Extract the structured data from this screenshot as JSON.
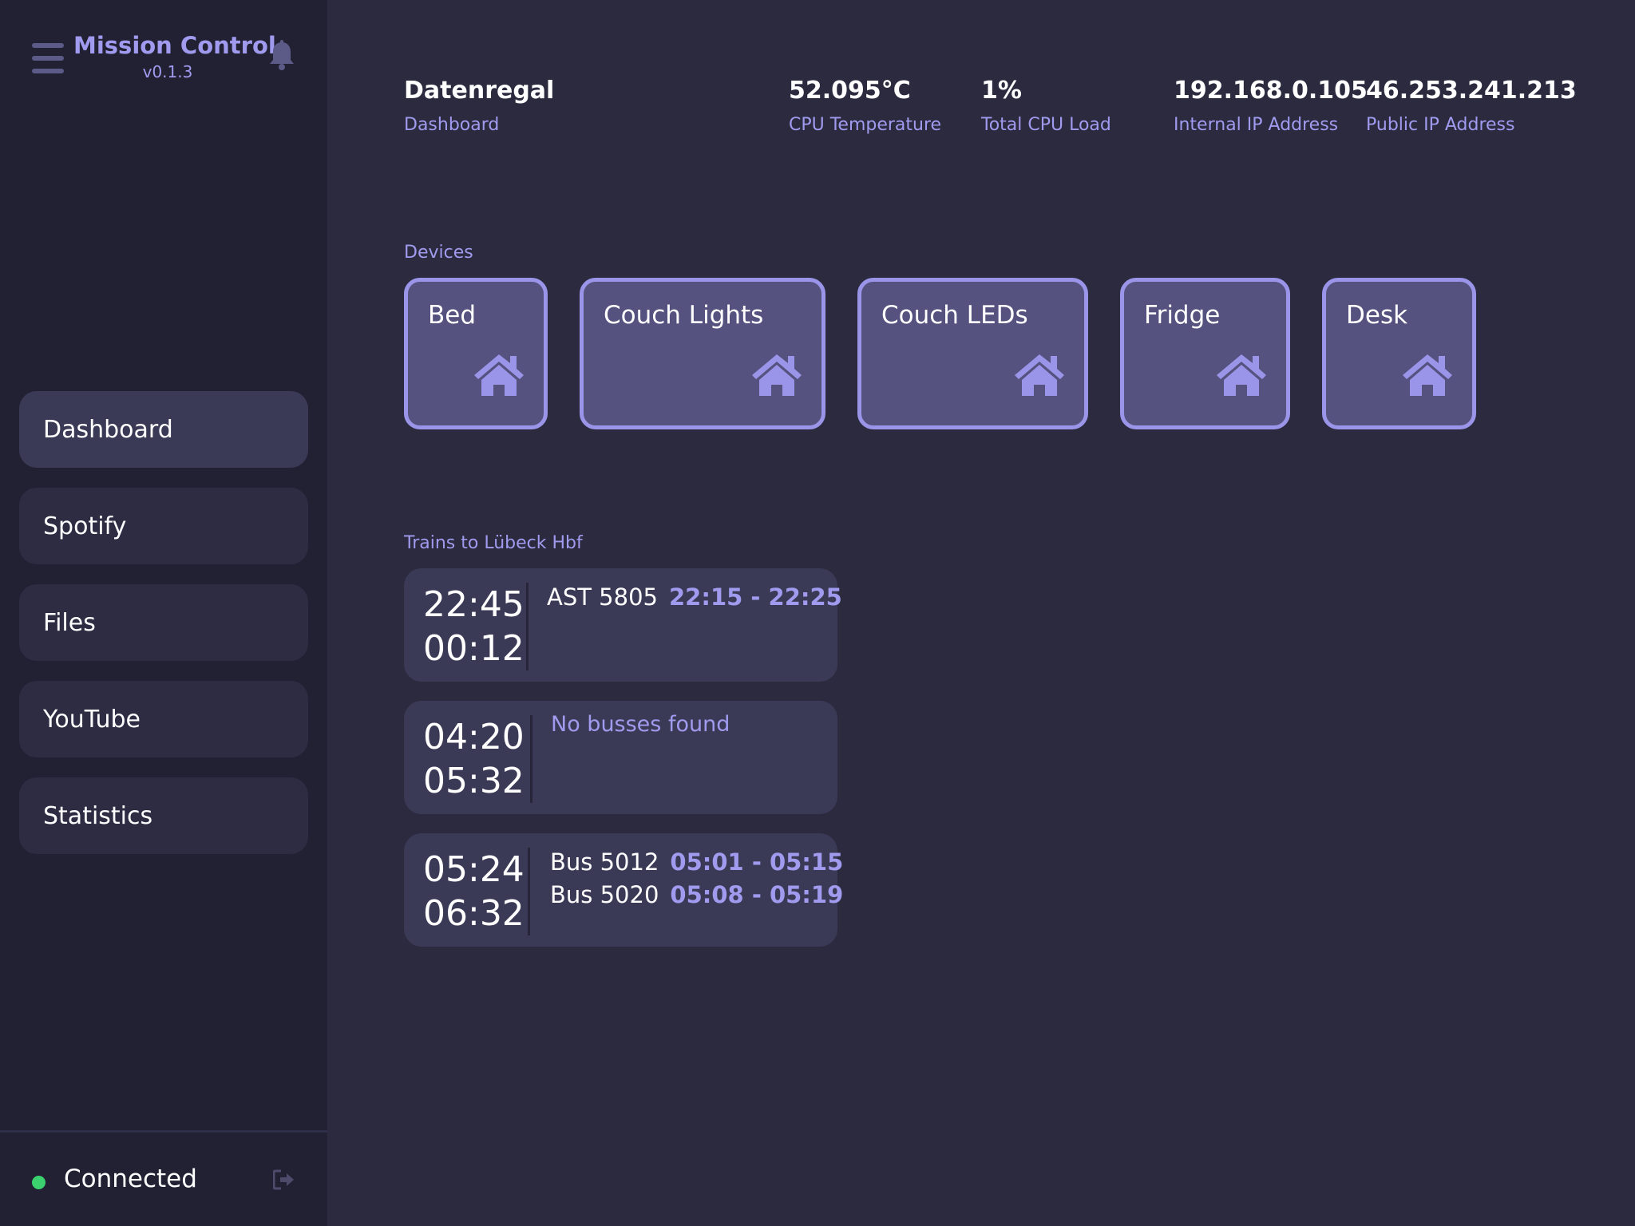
{
  "sidebar": {
    "app_title": "Mission Control",
    "version": "v0.1.3",
    "nav": [
      {
        "label": "Dashboard",
        "active": true
      },
      {
        "label": "Spotify",
        "active": false
      },
      {
        "label": "Files",
        "active": false
      },
      {
        "label": "YouTube",
        "active": false
      },
      {
        "label": "Statistics",
        "active": false
      }
    ],
    "connection_status": "Connected",
    "status_color": "#3bd16f"
  },
  "header": {
    "title": "Datenregal",
    "subtitle": "Dashboard",
    "stats": [
      {
        "value": "52.095°C",
        "label": "CPU Temperature"
      },
      {
        "value": "1%",
        "label": "Total CPU Load"
      },
      {
        "value": "192.168.0.105",
        "label": "Internal IP Address"
      },
      {
        "value": "46.253.241.213",
        "label": "Public IP Address"
      }
    ]
  },
  "devices": {
    "label": "Devices",
    "icon": "home-icon",
    "items": [
      {
        "name": "Bed"
      },
      {
        "name": "Couch Lights"
      },
      {
        "name": "Couch LEDs"
      },
      {
        "name": "Fridge"
      },
      {
        "name": "Desk"
      }
    ]
  },
  "trains": {
    "label": "Trains to Lübeck Hbf",
    "cards": [
      {
        "departure": "22:45",
        "arrival": "00:12",
        "connections": [
          {
            "line": "AST 5805",
            "span": "22:15  - 22:25"
          }
        ],
        "empty_text": ""
      },
      {
        "departure": "04:20",
        "arrival": "05:32",
        "connections": [],
        "empty_text": "No busses found"
      },
      {
        "departure": "05:24",
        "arrival": "06:32",
        "connections": [
          {
            "line": "Bus 5012",
            "span": "05:01  - 05:15"
          },
          {
            "line": "Bus 5020",
            "span": "05:08  - 05:19"
          }
        ],
        "empty_text": ""
      }
    ]
  },
  "colors": {
    "background": "#2b2a3f",
    "sidebar": "#222133",
    "accent": "#a19bef",
    "device_border": "#9b95ea",
    "device_fill": "#56527f",
    "card": "#3b3a56"
  }
}
